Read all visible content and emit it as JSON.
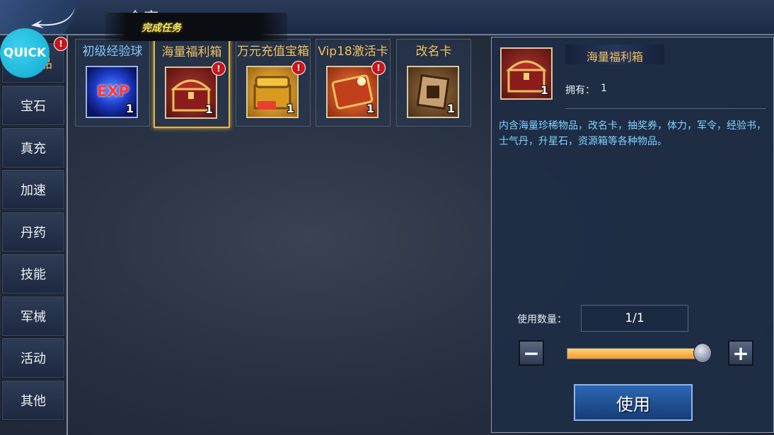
{
  "header": {
    "title": "仓库",
    "quest_banner": "完成任务"
  },
  "quick_button": {
    "label": "QUICK"
  },
  "sidebar": {
    "badge": "!",
    "items": [
      {
        "label": "消耗品",
        "active": true
      },
      {
        "label": "宝石"
      },
      {
        "label": "真充"
      },
      {
        "label": "加速"
      },
      {
        "label": "丹药"
      },
      {
        "label": "技能"
      },
      {
        "label": "军械"
      },
      {
        "label": "活动"
      },
      {
        "label": "其他"
      }
    ]
  },
  "items": [
    {
      "name": "初级经验球",
      "count": "1",
      "icon": "exp-orb-icon",
      "icon_text": "EXP",
      "badge": false
    },
    {
      "name": "海量福利箱",
      "count": "1",
      "icon": "red-chest-icon",
      "badge": true,
      "selected": true
    },
    {
      "name": "万元充值宝箱",
      "count": "1",
      "icon": "gold-chest-icon",
      "badge": true
    },
    {
      "name": "Vip18激活卡",
      "count": "1",
      "icon": "vip-card-icon",
      "badge": true
    },
    {
      "name": "改名卡",
      "count": "1",
      "icon": "rename-card-icon",
      "badge": false
    }
  ],
  "detail": {
    "name": "海量福利箱",
    "owned_label": "拥有：",
    "owned_value": "1",
    "count": "1",
    "description": "内含海量珍稀物品，改名卡，抽奖券，体力，军令，经验书，士气丹，升星石，资源箱等各种物品。",
    "quantity_label": "使用数量：",
    "quantity_value": "1/1",
    "quantity_fraction": 1.0,
    "minus_label": "−",
    "plus_label": "+",
    "use_label": "使用"
  },
  "colors": {
    "item_name": "#f0c060",
    "description": "#7fd3ff",
    "badge": "#c8161c",
    "quick": "#1fb4da"
  }
}
